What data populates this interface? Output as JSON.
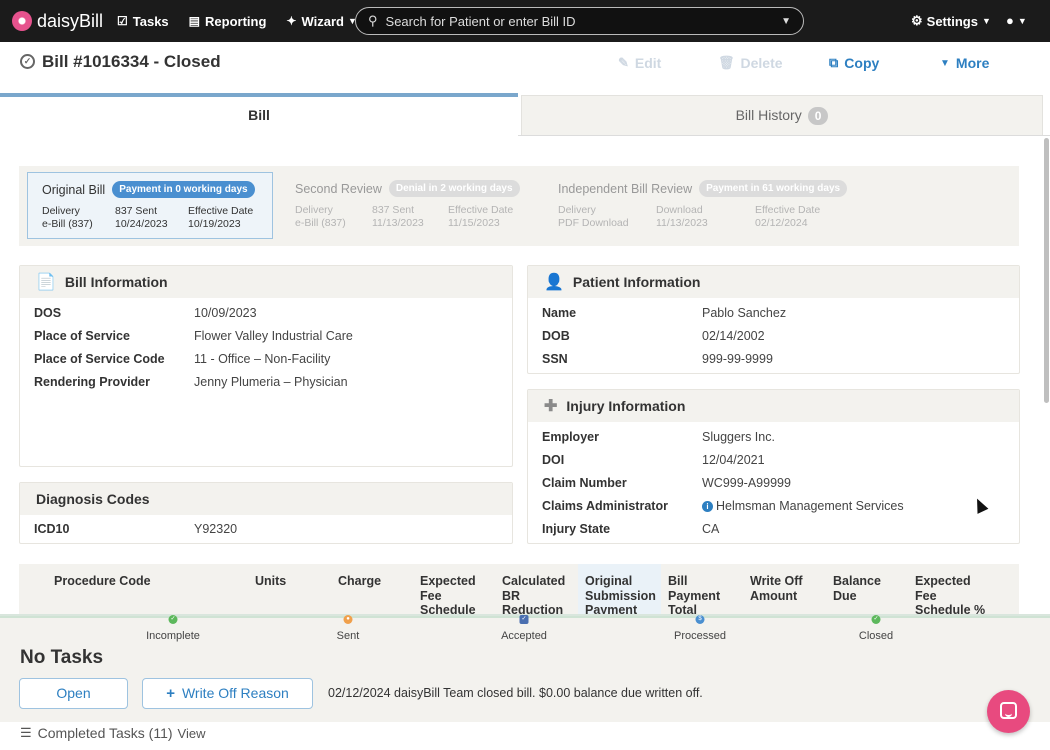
{
  "app": {
    "logo_text": "daisyBill"
  },
  "nav": {
    "tasks": "Tasks",
    "reporting": "Reporting",
    "wizard": "Wizard",
    "search_placeholder": "Search for Patient or enter Bill ID",
    "settings": "Settings"
  },
  "titlebar": {
    "title": "Bill #1016334 - Closed",
    "edit": "Edit",
    "delete": "Delete",
    "copy": "Copy",
    "more": "More"
  },
  "tabs": {
    "bill": "Bill",
    "history": "Bill History",
    "history_count": "0"
  },
  "reviews": {
    "original": {
      "title": "Original Bill",
      "pill": "Payment in 0 working days",
      "c1_label": "Delivery",
      "c1_value": "e-Bill (837)",
      "c2_label": "837 Sent",
      "c2_value": "10/24/2023",
      "c3_label": "Effective Date",
      "c3_value": "10/19/2023"
    },
    "second": {
      "title": "Second Review",
      "pill": "Denial in 2 working days",
      "c1_label": "Delivery",
      "c1_value": "e-Bill (837)",
      "c2_label": "837 Sent",
      "c2_value": "11/13/2023",
      "c3_label": "Effective Date",
      "c3_value": "11/15/2023"
    },
    "ibr": {
      "title": "Independent Bill Review",
      "pill": "Payment in 61 working days",
      "c1_label": "Delivery",
      "c1_value": "PDF Download",
      "c2_label": "Download",
      "c2_value": "11/13/2023",
      "c3_label": "Effective Date",
      "c3_value": "02/12/2024"
    }
  },
  "bill_info": {
    "heading": "Bill Information",
    "dos_k": "DOS",
    "dos_v": "10/09/2023",
    "pos_k": "Place of Service",
    "pos_v": "Flower Valley Industrial Care",
    "posc_k": "Place of Service Code",
    "posc_v": "11 - Office – Non-Facility",
    "rp_k": "Rendering Provider",
    "rp_v": "Jenny Plumeria – Physician"
  },
  "diagnosis": {
    "heading": "Diagnosis Codes",
    "code_k": "ICD10",
    "code_v": "Y92320"
  },
  "patient": {
    "heading": "Patient Information",
    "name_k": "Name",
    "name_v": "Pablo Sanchez",
    "dob_k": "DOB",
    "dob_v": "02/14/2002",
    "ssn_k": "SSN",
    "ssn_v": "999-99-9999"
  },
  "injury": {
    "heading": "Injury Information",
    "emp_k": "Employer",
    "emp_v": "Sluggers Inc.",
    "doi_k": "DOI",
    "doi_v": "12/04/2021",
    "claim_k": "Claim Number",
    "claim_v": "WC999-A99999",
    "admin_k": "Claims Administrator",
    "admin_v": "Helmsman Management Services",
    "state_k": "Injury State",
    "state_v": "CA"
  },
  "procedure_table": {
    "headers": [
      "Procedure Code",
      "Units",
      "Charge",
      "Expected Fee Schedule",
      "Calculated BR Reduction",
      "Original Submission Payment",
      "Bill Payment Total",
      "Write Off Amount",
      "Balance Due",
      "Expected Fee Schedule %"
    ]
  },
  "progress": {
    "steps": [
      "Incomplete",
      "Sent",
      "Accepted",
      "Processed",
      "Closed"
    ]
  },
  "tasks": {
    "heading": "No Tasks",
    "open_btn": "Open",
    "writeoff_btn": "Write Off Reason",
    "note": "02/12/2024 daisyBill Team closed bill. $0.00 balance due written off.",
    "completed_label": "Completed Tasks (11)",
    "view": "View"
  },
  "colors": {
    "nav_bg": "#1b1b1b",
    "accent": "#2d7fc1",
    "brand_pink": "#e84a7f",
    "panel_bg": "#f3f2ee"
  }
}
